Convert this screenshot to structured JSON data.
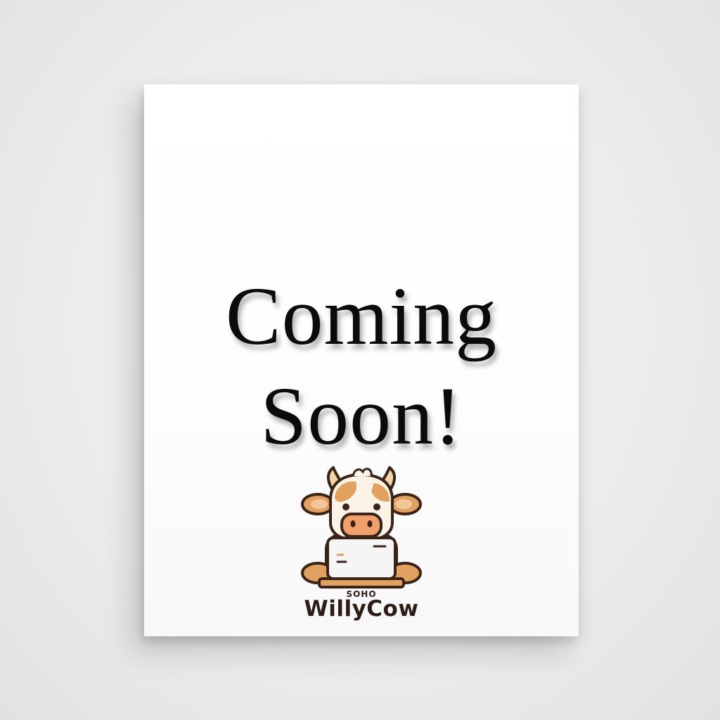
{
  "poster": {
    "headline_line1": "Coming",
    "headline_line2": "Soon!"
  },
  "logo": {
    "icon": "cow-with-laptop-icon",
    "subtitle": "SOHO",
    "name": "WillyCow"
  },
  "colors": {
    "background": "#ececec",
    "paper": "#ffffff",
    "text": "#0b0b0b",
    "cow_accent": "#e2a15e",
    "cow_outline": "#3a2418",
    "snout": "#f0a06a"
  }
}
